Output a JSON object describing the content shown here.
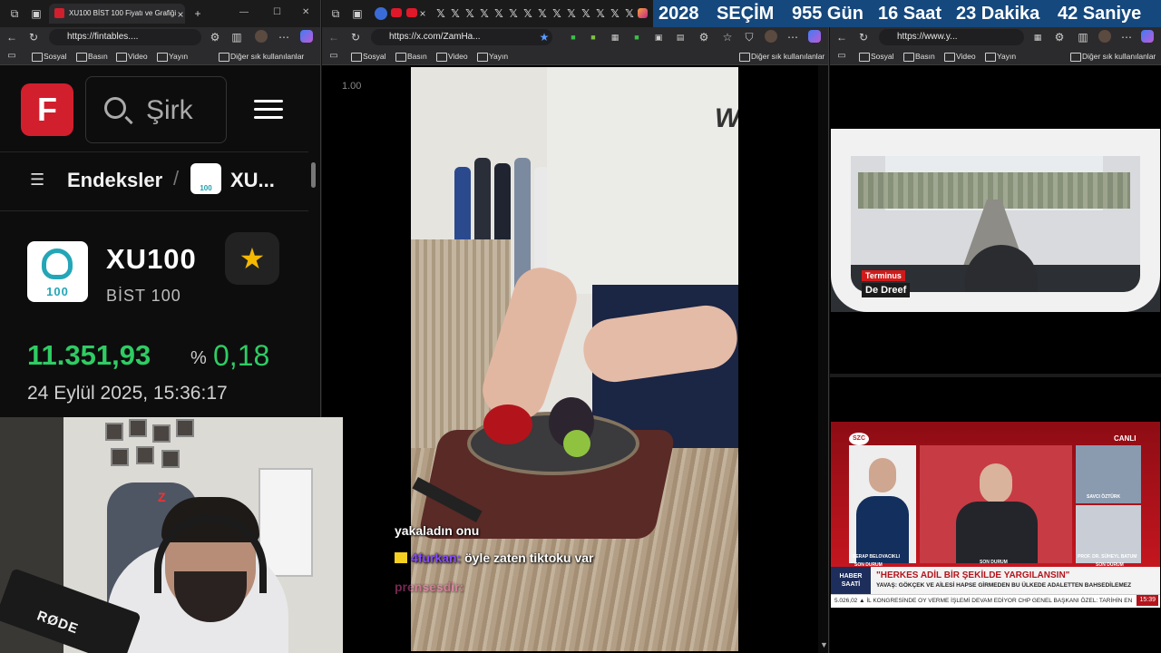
{
  "windows": {
    "left": {
      "tab_title": "XU100 BİST 100 Fiyatı ve Grafiği",
      "url": "https://fintables....",
      "bookmarks": [
        "Sosyal",
        "Basın",
        "Video",
        "Yayın"
      ],
      "other_bookmarks": "Diğer sık kullanılanlar",
      "page": {
        "logo_letter": "F",
        "search_placeholder": "Şirk",
        "breadcrumb_root": "Endeksler",
        "breadcrumb_current": "XU...",
        "index_code": "XU100",
        "index_name": "BİST 100",
        "index_logo_text": "100",
        "price": "11.351,93",
        "change_symbol": "%",
        "change_pct": "0,18",
        "datetime": "24 Eylül 2025, 15:36:17",
        "colors": {
          "brand": "#d21f2d",
          "up": "#2fcc63",
          "star": "#f5b800"
        }
      }
    },
    "middle": {
      "url": "https://x.com/ZamHa...",
      "bookmarks": [
        "Sosyal",
        "Basın",
        "Video",
        "Yayın"
      ],
      "other_bookmarks": "Diğer sık kullanılanlar",
      "playback_rate": "1.00",
      "video_shirt_logo": "W",
      "chat": [
        {
          "user": "",
          "message": "yakaladın onu",
          "faded": false
        },
        {
          "user": "4furkan:",
          "message": "öyle zaten tiktoku var",
          "faded": false
        },
        {
          "user": "prensesdir:",
          "message": "",
          "faded": true
        }
      ]
    },
    "right": {
      "url": "https://www.y...",
      "bookmarks": [
        "Sosyal",
        "Basın",
        "Video",
        "Yayın"
      ],
      "other_bookmarks": "Diğer sık kullanılanlar",
      "countdown": {
        "year": "2028",
        "label": "SEÇİM",
        "days": "955 Gün",
        "hours": "16 Saat",
        "minutes": "23 Dakika",
        "seconds": "42 Saniye"
      },
      "tram_stream": {
        "tag": "Terminus",
        "stop": "De Dreef"
      },
      "news": {
        "channel": "SZC",
        "live": "CANLI",
        "label": "HABER SAATİ",
        "headline": "\"HERKES ADİL BİR ŞEKİLDE YARGILANSIN\"",
        "subline": "YAVAŞ: GÖKÇEK VE AİLESİ HAPSE GİRMEDEN BU ÜLKEDE ADALETTEN BAHSEDİLEMEZ",
        "ticker": "5.026,02 ▲   İL KONGRESİNDE OY VERME İŞLEMİ DEVAM EDİYOR    CHP GENEL BAŞKANI ÖZEL: TARİHİN EN",
        "time": "15:39",
        "captions": [
          "SERAP BELOVACIKLI",
          "SON DURUM",
          "SAVCI ÖZTÜRK",
          "PROF. DR. SÜHEYL BATUM",
          "SON DURUM",
          "SON DURUM"
        ]
      }
    }
  },
  "webcam": {
    "mic_brand": "RØDE",
    "chair_brand": "Z"
  }
}
